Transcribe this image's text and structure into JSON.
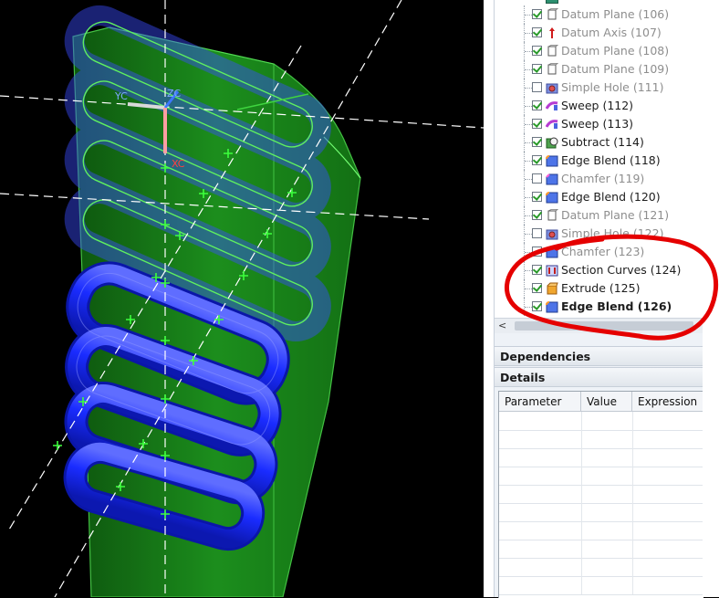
{
  "viewport": {
    "background": "#000000",
    "axis_labels": {
      "yc": "YC",
      "zc": "ZC",
      "xc": "XC"
    },
    "colors": {
      "body": "#1c8a1c",
      "wire": "#5ff05f",
      "coil_solid": "#1a2cff",
      "coil_ghost": "#3a4dff",
      "datum": "#ffffff",
      "annotation": "#e00000"
    }
  },
  "part_navigator": {
    "rows": [
      {
        "label": "Datum Plane (106)",
        "icon": "datum-plane-icon",
        "checked": true,
        "suppressed": true,
        "bold": false
      },
      {
        "label": "Datum Axis (107)",
        "icon": "datum-axis-icon",
        "checked": true,
        "suppressed": true,
        "bold": false
      },
      {
        "label": "Datum Plane (108)",
        "icon": "datum-plane-icon",
        "checked": true,
        "suppressed": true,
        "bold": false
      },
      {
        "label": "Datum Plane (109)",
        "icon": "datum-plane-icon",
        "checked": true,
        "suppressed": true,
        "bold": false
      },
      {
        "label": "Simple Hole (111)",
        "icon": "simple-hole-icon",
        "checked": false,
        "suppressed": true,
        "bold": false
      },
      {
        "label": "Sweep (112)",
        "icon": "sweep-icon",
        "checked": true,
        "suppressed": false,
        "bold": false
      },
      {
        "label": "Sweep (113)",
        "icon": "sweep-icon",
        "checked": true,
        "suppressed": false,
        "bold": false
      },
      {
        "label": "Subtract (114)",
        "icon": "subtract-icon",
        "checked": true,
        "suppressed": false,
        "bold": false
      },
      {
        "label": "Edge Blend (118)",
        "icon": "edge-blend-icon",
        "checked": true,
        "suppressed": false,
        "bold": false
      },
      {
        "label": "Chamfer (119)",
        "icon": "chamfer-icon",
        "checked": false,
        "suppressed": true,
        "bold": false
      },
      {
        "label": "Edge Blend (120)",
        "icon": "edge-blend-icon",
        "checked": true,
        "suppressed": false,
        "bold": false
      },
      {
        "label": "Datum Plane (121)",
        "icon": "datum-plane-icon",
        "checked": true,
        "suppressed": true,
        "bold": false
      },
      {
        "label": "Simple Hole (122)",
        "icon": "simple-hole-icon",
        "checked": false,
        "suppressed": true,
        "bold": false
      },
      {
        "label": "Chamfer (123)",
        "icon": "chamfer-icon",
        "checked": false,
        "suppressed": true,
        "bold": false
      },
      {
        "label": "Section Curves (124)",
        "icon": "section-curves-icon",
        "checked": true,
        "suppressed": false,
        "bold": false
      },
      {
        "label": "Extrude (125)",
        "icon": "extrude-icon",
        "checked": true,
        "suppressed": false,
        "bold": false
      },
      {
        "label": "Edge Blend (126)",
        "icon": "edge-blend-icon",
        "checked": true,
        "suppressed": false,
        "bold": true
      }
    ],
    "scroll_left_arrow": "<"
  },
  "dependencies": {
    "title": "Dependencies"
  },
  "details": {
    "title": "Details",
    "columns": [
      "Parameter",
      "Value",
      "Expression"
    ],
    "empty_rows": 10
  }
}
